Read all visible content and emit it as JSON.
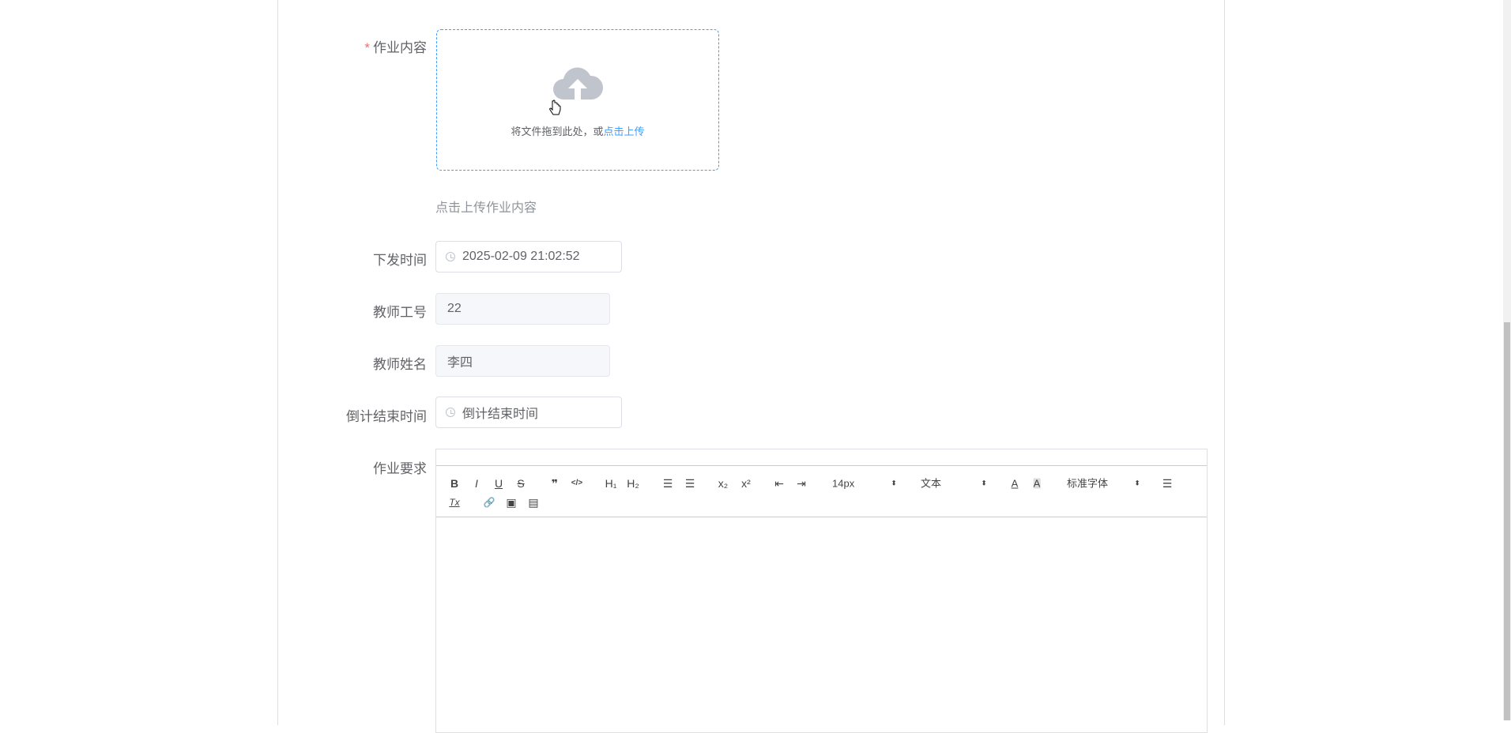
{
  "form": {
    "content": {
      "required_mark": "*",
      "label": "作业内容",
      "upload_text": "将文件拖到此处，或",
      "upload_link": "点击上传",
      "hint": "点击上传作业内容"
    },
    "issue_time": {
      "label": "下发时间",
      "value": "2025-02-09 21:02:52"
    },
    "teacher_id": {
      "label": "教师工号",
      "value": "22"
    },
    "teacher_name": {
      "label": "教师姓名",
      "value": "李四"
    },
    "countdown_end": {
      "label": "倒计结束时间",
      "placeholder": "倒计结束时间"
    },
    "requirements": {
      "label": "作业要求"
    }
  },
  "toolbar": {
    "bold": "B",
    "italic": "I",
    "underline": "U",
    "strike": "S",
    "blockquote": "❞",
    "code": "</>",
    "h1": "H₁",
    "h2": "H₂",
    "ordered_list": "☰",
    "bullet_list": "☰",
    "subscript": "x₂",
    "superscript": "x²",
    "outdent": "⇤",
    "indent": "⇥",
    "size": "14px",
    "header": "文本",
    "font": "标准字体",
    "color": "A",
    "background": "A",
    "align": "☰",
    "clean": "Tx",
    "link": "🔗",
    "image": "▣",
    "video": "▤"
  }
}
